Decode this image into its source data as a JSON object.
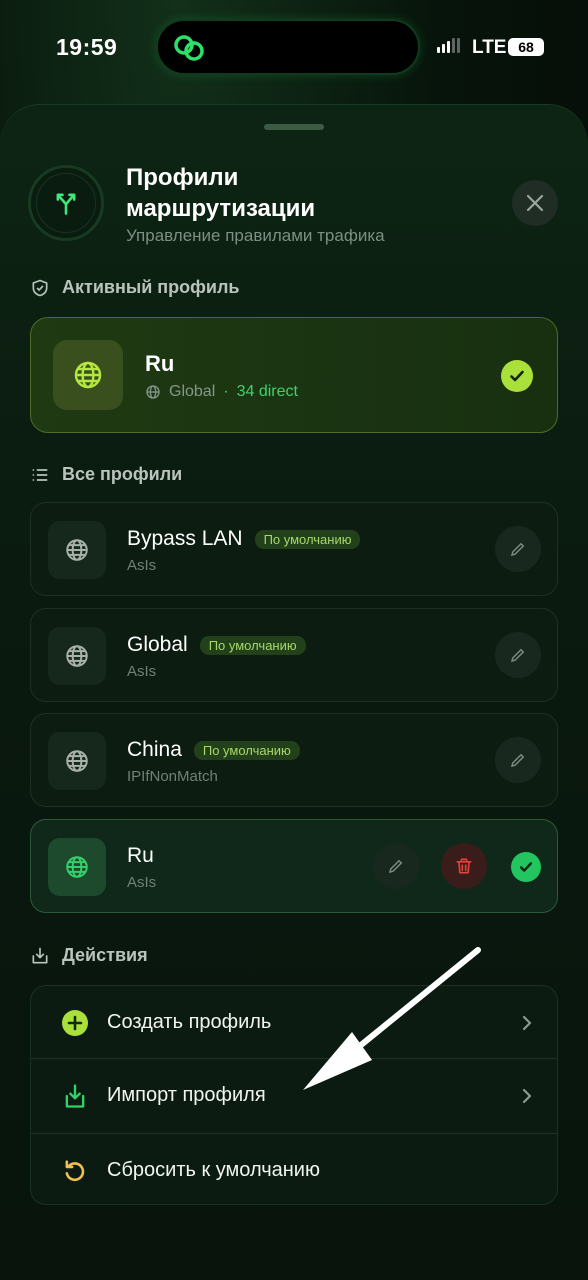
{
  "status_bar": {
    "time": "19:59",
    "network": "LTE",
    "battery": "68"
  },
  "header": {
    "title": "Профили маршрутизации",
    "subtitle": "Управление правилами трафика"
  },
  "active_section": {
    "label": "Активный профиль",
    "profile": {
      "name": "Ru",
      "mode": "Global",
      "direct": "34 direct"
    }
  },
  "all_section": {
    "label": "Все профили",
    "profiles": [
      {
        "name": "Bypass LAN",
        "badge": "По умолчанию",
        "strategy": "AsIs"
      },
      {
        "name": "Global",
        "badge": "По умолчанию",
        "strategy": "AsIs"
      },
      {
        "name": "China",
        "badge": "По умолчанию",
        "strategy": "IPIfNonMatch"
      },
      {
        "name": "Ru",
        "strategy": "AsIs"
      }
    ]
  },
  "actions_section": {
    "label": "Действия",
    "items": [
      {
        "label": "Создать профиль"
      },
      {
        "label": "Импорт профиля"
      },
      {
        "label": "Сбросить к умолчанию"
      }
    ]
  },
  "colors": {
    "accent_lime": "#a9e03a",
    "accent_green": "#22c55e",
    "danger": "#e0443a"
  }
}
